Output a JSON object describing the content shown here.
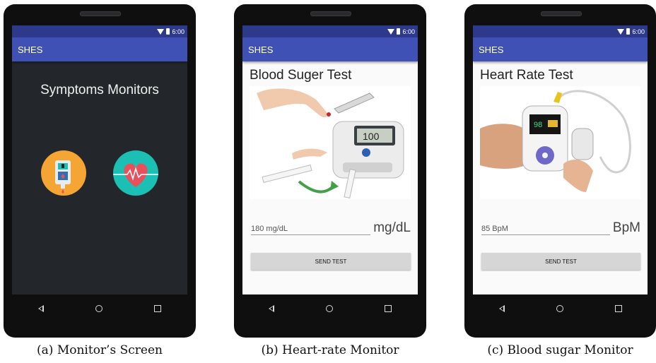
{
  "status": {
    "time": "6:00"
  },
  "screens": {
    "monitor": {
      "app_title": "SHES",
      "heading": "Symptoms Monitors",
      "caption": "(a) Monitor’s Screen"
    },
    "sugar": {
      "app_title": "SHES",
      "heading": "Blood Suger Test",
      "value": "180 mg/dL",
      "unit": "mg/dL",
      "button": "SEND TEST",
      "meter_display": "100",
      "caption": "(b) Heart-rate Monitor"
    },
    "heart": {
      "app_title": "SHES",
      "heading": "Heart Rate Test",
      "value": "85 BpM",
      "unit": "BpM",
      "button": "SEND TEST",
      "oximeter_display": "98",
      "caption": "(c) Blood sugar Monitor"
    }
  },
  "icons": [
    "wifi-icon",
    "battery-icon",
    "back-icon",
    "home-icon",
    "recent-apps-icon",
    "glucose-meter-icon",
    "heart-monitor-icon"
  ],
  "colors": {
    "status_bar": "#2d3a8c",
    "app_bar": "#3f51b5",
    "dark_screen": "#23262b",
    "glucose_icon": "#f4a534",
    "heart_icon": "#1bbfb4",
    "heart": "#e8505b"
  }
}
